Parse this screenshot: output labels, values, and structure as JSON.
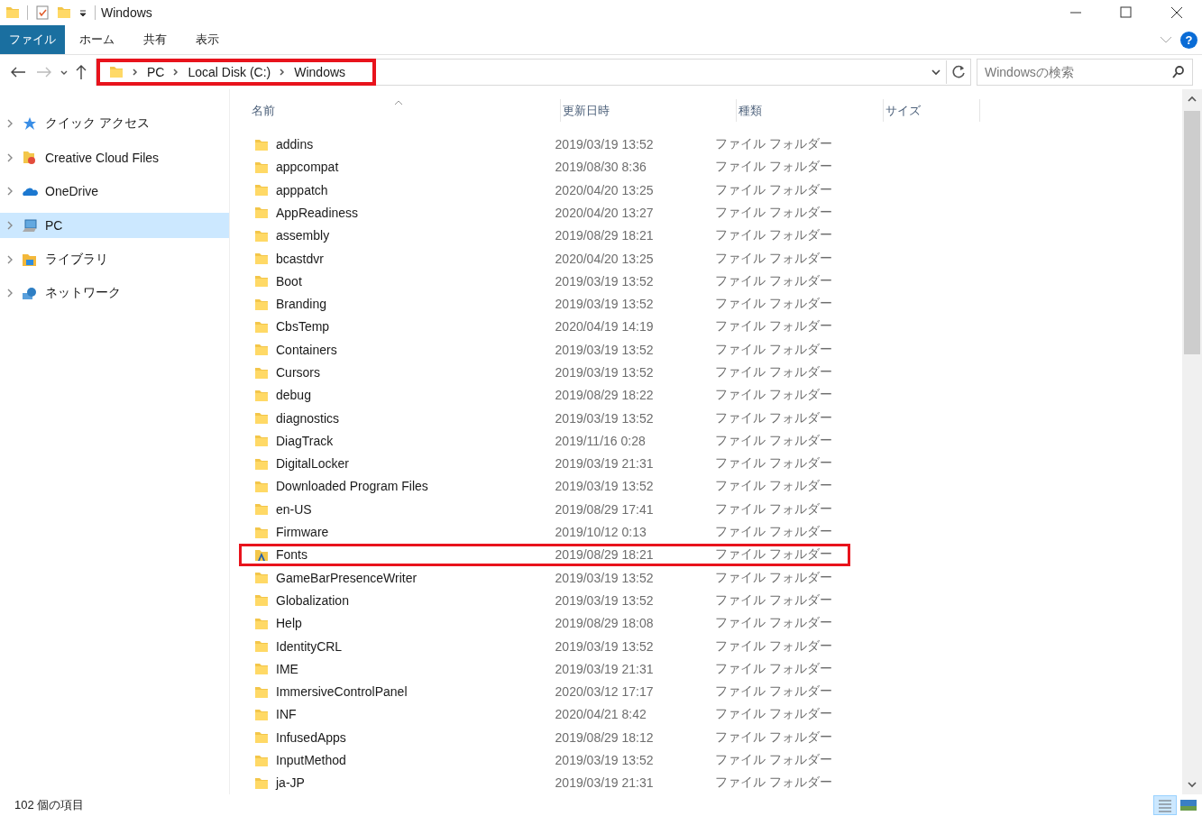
{
  "window": {
    "title": "Windows"
  },
  "ribbon_tabs": [
    {
      "label": "ファイル",
      "selected": true
    },
    {
      "label": "ホーム",
      "selected": false
    },
    {
      "label": "共有",
      "selected": false
    },
    {
      "label": "表示",
      "selected": false
    }
  ],
  "address_bar": {
    "highlighted": true,
    "path": [
      "PC",
      "Local Disk (C:)",
      "Windows"
    ]
  },
  "help": {
    "label": "?"
  },
  "search": {
    "placeholder": "Windowsの検索"
  },
  "sidebar": {
    "items": [
      {
        "label": "クイック アクセス",
        "kind": "star",
        "selected": false
      },
      {
        "label": "Creative Cloud Files",
        "kind": "cloudfolder",
        "selected": false
      },
      {
        "label": "OneDrive",
        "kind": "cloud",
        "selected": false
      },
      {
        "label": "PC",
        "kind": "pc",
        "selected": true
      },
      {
        "label": "ライブラリ",
        "kind": "library",
        "selected": false
      },
      {
        "label": "ネットワーク",
        "kind": "network",
        "selected": false
      }
    ]
  },
  "table": {
    "columns": [
      "名前",
      "更新日時",
      "種類",
      "サイズ"
    ],
    "rows": [
      {
        "name": "addins",
        "date": "2019/03/19 13:52",
        "type": "ファイル フォルダー",
        "kind": "folder",
        "highlighted": false
      },
      {
        "name": "appcompat",
        "date": "2019/08/30 8:36",
        "type": "ファイル フォルダー",
        "kind": "folder",
        "highlighted": false
      },
      {
        "name": "apppatch",
        "date": "2020/04/20 13:25",
        "type": "ファイル フォルダー",
        "kind": "folder",
        "highlighted": false
      },
      {
        "name": "AppReadiness",
        "date": "2020/04/20 13:27",
        "type": "ファイル フォルダー",
        "kind": "folder",
        "highlighted": false
      },
      {
        "name": "assembly",
        "date": "2019/08/29 18:21",
        "type": "ファイル フォルダー",
        "kind": "folder",
        "highlighted": false
      },
      {
        "name": "bcastdvr",
        "date": "2020/04/20 13:25",
        "type": "ファイル フォルダー",
        "kind": "folder",
        "highlighted": false
      },
      {
        "name": "Boot",
        "date": "2019/03/19 13:52",
        "type": "ファイル フォルダー",
        "kind": "folder",
        "highlighted": false
      },
      {
        "name": "Branding",
        "date": "2019/03/19 13:52",
        "type": "ファイル フォルダー",
        "kind": "folder",
        "highlighted": false
      },
      {
        "name": "CbsTemp",
        "date": "2020/04/19 14:19",
        "type": "ファイル フォルダー",
        "kind": "folder",
        "highlighted": false
      },
      {
        "name": "Containers",
        "date": "2019/03/19 13:52",
        "type": "ファイル フォルダー",
        "kind": "folder",
        "highlighted": false
      },
      {
        "name": "Cursors",
        "date": "2019/03/19 13:52",
        "type": "ファイル フォルダー",
        "kind": "folder",
        "highlighted": false
      },
      {
        "name": "debug",
        "date": "2019/08/29 18:22",
        "type": "ファイル フォルダー",
        "kind": "folder",
        "highlighted": false
      },
      {
        "name": "diagnostics",
        "date": "2019/03/19 13:52",
        "type": "ファイル フォルダー",
        "kind": "folder",
        "highlighted": false
      },
      {
        "name": "DiagTrack",
        "date": "2019/11/16 0:28",
        "type": "ファイル フォルダー",
        "kind": "folder",
        "highlighted": false
      },
      {
        "name": "DigitalLocker",
        "date": "2019/03/19 21:31",
        "type": "ファイル フォルダー",
        "kind": "folder",
        "highlighted": false
      },
      {
        "name": "Downloaded Program Files",
        "date": "2019/03/19 13:52",
        "type": "ファイル フォルダー",
        "kind": "folder",
        "highlighted": false
      },
      {
        "name": "en-US",
        "date": "2019/08/29 17:41",
        "type": "ファイル フォルダー",
        "kind": "folder",
        "highlighted": false
      },
      {
        "name": "Firmware",
        "date": "2019/10/12 0:13",
        "type": "ファイル フォルダー",
        "kind": "folder",
        "highlighted": false
      },
      {
        "name": "Fonts",
        "date": "2019/08/29 18:21",
        "type": "ファイル フォルダー",
        "kind": "fonts",
        "highlighted": true
      },
      {
        "name": "GameBarPresenceWriter",
        "date": "2019/03/19 13:52",
        "type": "ファイル フォルダー",
        "kind": "folder",
        "highlighted": false
      },
      {
        "name": "Globalization",
        "date": "2019/03/19 13:52",
        "type": "ファイル フォルダー",
        "kind": "folder",
        "highlighted": false
      },
      {
        "name": "Help",
        "date": "2019/08/29 18:08",
        "type": "ファイル フォルダー",
        "kind": "folder",
        "highlighted": false
      },
      {
        "name": "IdentityCRL",
        "date": "2019/03/19 13:52",
        "type": "ファイル フォルダー",
        "kind": "folder",
        "highlighted": false
      },
      {
        "name": "IME",
        "date": "2019/03/19 21:31",
        "type": "ファイル フォルダー",
        "kind": "folder",
        "highlighted": false
      },
      {
        "name": "ImmersiveControlPanel",
        "date": "2020/03/12 17:17",
        "type": "ファイル フォルダー",
        "kind": "folder",
        "highlighted": false
      },
      {
        "name": "INF",
        "date": "2020/04/21 8:42",
        "type": "ファイル フォルダー",
        "kind": "folder",
        "highlighted": false
      },
      {
        "name": "InfusedApps",
        "date": "2019/08/29 18:12",
        "type": "ファイル フォルダー",
        "kind": "folder",
        "highlighted": false
      },
      {
        "name": "InputMethod",
        "date": "2019/03/19 13:52",
        "type": "ファイル フォルダー",
        "kind": "folder",
        "highlighted": false
      },
      {
        "name": "ja-JP",
        "date": "2019/03/19 21:31",
        "type": "ファイル フォルダー",
        "kind": "folder",
        "highlighted": false
      }
    ]
  },
  "status_bar": {
    "count": "102 個の項目"
  }
}
